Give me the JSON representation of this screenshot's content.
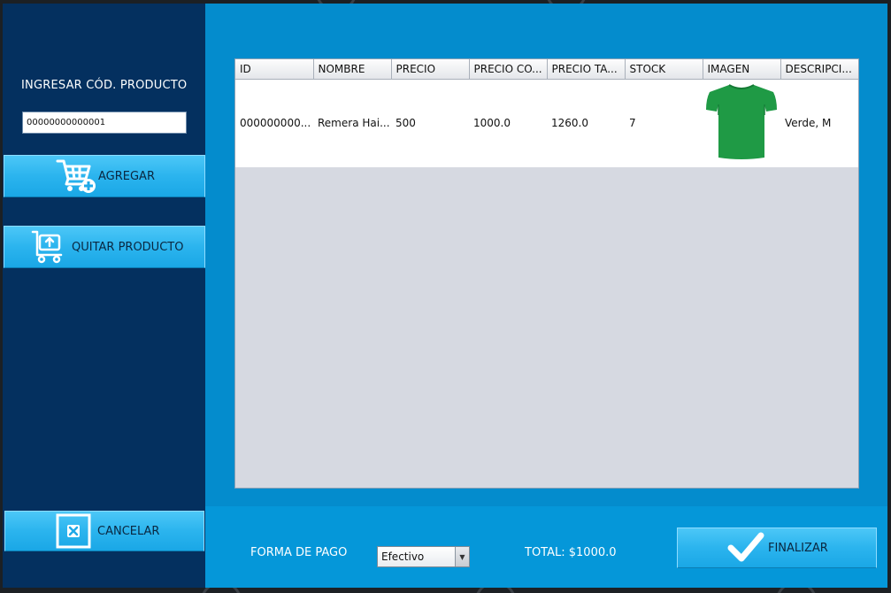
{
  "sidebar": {
    "code_label": "INGRESAR CÓD. PRODUCTO",
    "code_value": "00000000000001",
    "add_label": "AGREGAR",
    "remove_label": "QUITAR PRODUCTO",
    "cancel_label": "CANCELAR"
  },
  "table": {
    "columns": [
      "ID",
      "NOMBRE",
      "PRECIO",
      "PRECIO CO...",
      "PRECIO TA...",
      "STOCK",
      "IMAGEN",
      "DESCRIPCI..."
    ],
    "rows": [
      {
        "id": "000000000...",
        "nombre": "Remera Hai...",
        "precio": "500",
        "precio_co": "1000.0",
        "precio_ta": "1260.0",
        "stock": "7",
        "imagen_icon": "green-tshirt-icon",
        "descripcion": "Verde, M"
      }
    ]
  },
  "footer": {
    "payment_label": "FORMA DE PAGO",
    "payment_selected": "Efectivo",
    "total": "TOTAL: $1000.0",
    "finish_label": "FINALIZAR"
  },
  "colors": {
    "sidebar": "#04305f",
    "main": "#048ccd",
    "button": "#2bb4ee",
    "shirt": "#1f9a45"
  }
}
